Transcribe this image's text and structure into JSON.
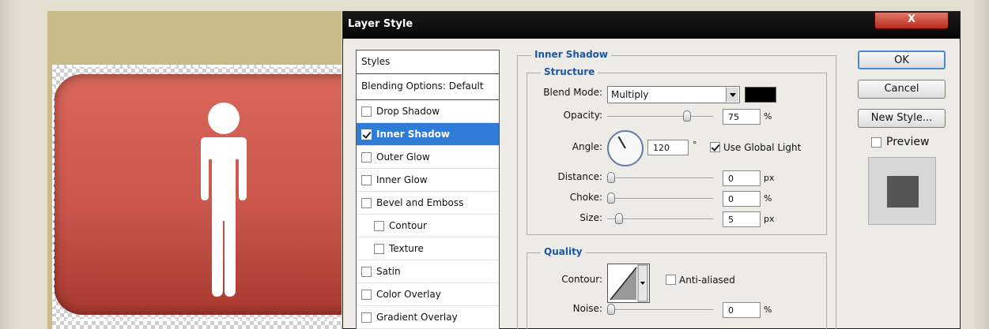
{
  "window": {
    "title": "Layer Style",
    "close_label": "X"
  },
  "styles_panel": {
    "header": "Styles",
    "blending": "Blending Options: Default",
    "items": [
      {
        "label": "Drop Shadow",
        "checked": false,
        "selected": false,
        "indent": false
      },
      {
        "label": "Inner Shadow",
        "checked": true,
        "selected": true,
        "indent": false
      },
      {
        "label": "Outer Glow",
        "checked": false,
        "selected": false,
        "indent": false
      },
      {
        "label": "Inner Glow",
        "checked": false,
        "selected": false,
        "indent": false
      },
      {
        "label": "Bevel and Emboss",
        "checked": false,
        "selected": false,
        "indent": false
      },
      {
        "label": "Contour",
        "checked": false,
        "selected": false,
        "indent": true
      },
      {
        "label": "Texture",
        "checked": false,
        "selected": false,
        "indent": true
      },
      {
        "label": "Satin",
        "checked": false,
        "selected": false,
        "indent": false
      },
      {
        "label": "Color Overlay",
        "checked": false,
        "selected": false,
        "indent": false
      },
      {
        "label": "Gradient Overlay",
        "checked": false,
        "selected": false,
        "indent": false
      }
    ]
  },
  "inner_shadow": {
    "section_title": "Inner Shadow",
    "structure": {
      "title": "Structure",
      "blend_mode_label": "Blend Mode:",
      "blend_mode_value": "Multiply",
      "shadow_color": "#000000",
      "opacity_label": "Opacity:",
      "opacity_value": "75",
      "opacity_unit": "%",
      "opacity_level": 0.75,
      "angle_label": "Angle:",
      "angle_value": "120",
      "angle_unit": "°",
      "global_light_label": "Use Global Light",
      "global_light_checked": true,
      "distance_label": "Distance:",
      "distance_value": "0",
      "distance_unit": "px",
      "choke_label": "Choke:",
      "choke_value": "0",
      "choke_unit": "%",
      "size_label": "Size:",
      "size_value": "5",
      "size_unit": "px"
    },
    "quality": {
      "title": "Quality",
      "contour_label": "Contour:",
      "antialiased_label": "Anti-aliased",
      "antialiased_checked": false,
      "noise_label": "Noise:",
      "noise_value": "0",
      "noise_unit": "%"
    }
  },
  "buttons": {
    "ok": "OK",
    "cancel": "Cancel",
    "new_style": "New Style...",
    "preview_label": "Preview",
    "preview_checked": false
  },
  "colors": {
    "accent": "#2f7bd6",
    "section_title": "#1e56a0",
    "button_red": "#c9574c"
  }
}
